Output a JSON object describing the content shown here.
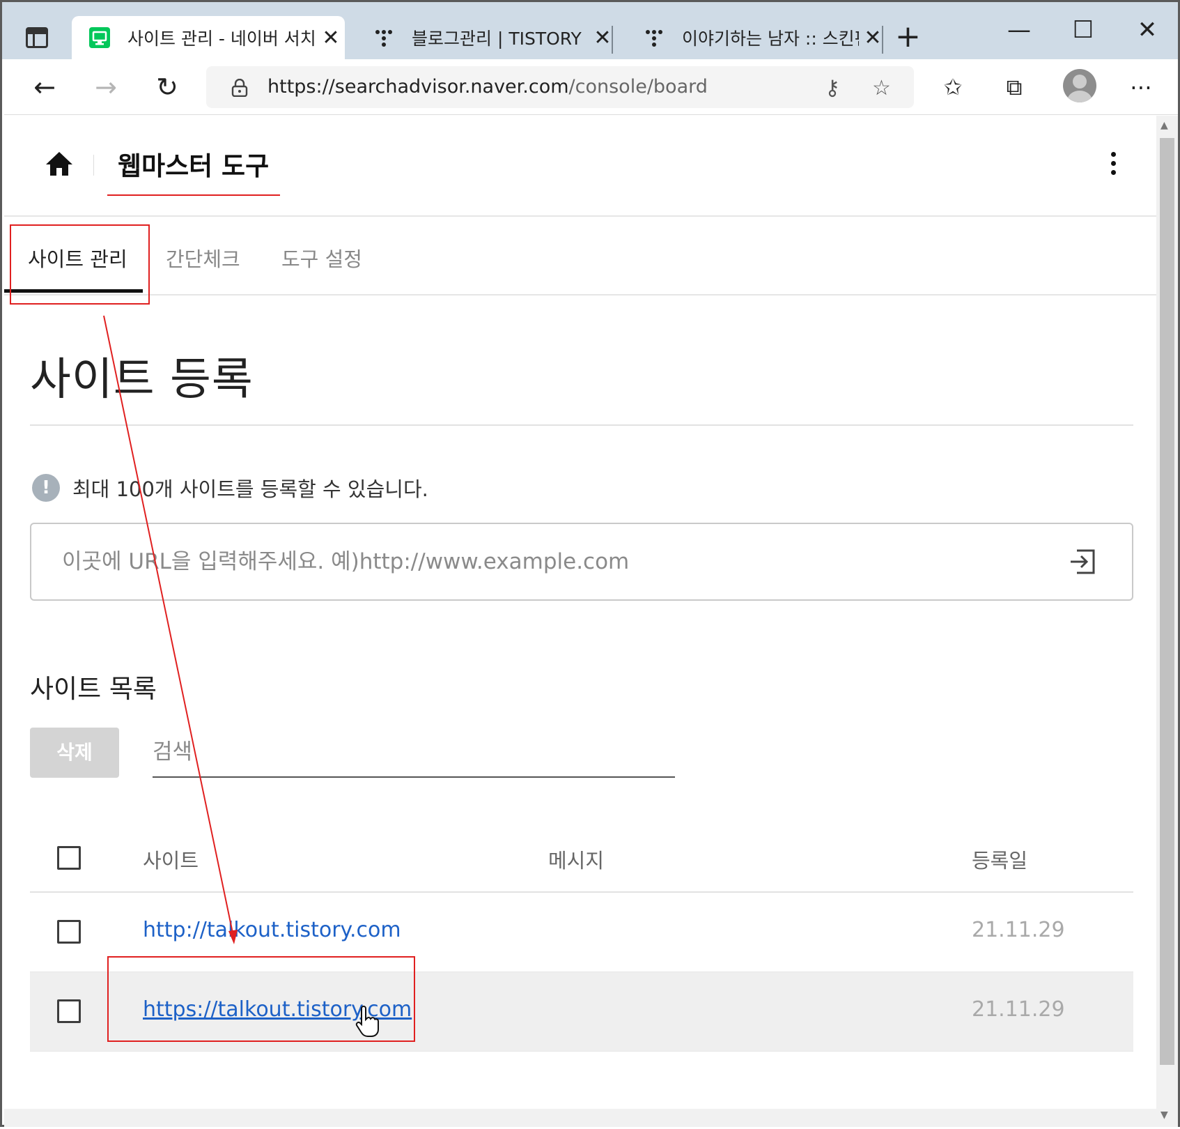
{
  "browser": {
    "tabs": [
      {
        "title": "사이트 관리 - 네이버 서치어드바이저",
        "icon": "naver-searchadvisor-icon",
        "active": true
      },
      {
        "title": "블로그관리 | TISTORY",
        "icon": "tistory-icon",
        "active": false
      },
      {
        "title": "이야기하는 남자 :: 스킨편집",
        "icon": "tistory-icon",
        "active": false
      }
    ],
    "url_host": "https://searchadvisor.naver.com",
    "url_path": "/console/board"
  },
  "header": {
    "title": "웹마스터 도구"
  },
  "page_tabs": [
    "사이트 관리",
    "간단체크",
    "도구 설정"
  ],
  "register": {
    "title": "사이트 등록",
    "notice_icon": "!",
    "notice": "최대 100개 사이트를 등록할 수 있습니다.",
    "input_placeholder": "이곳에 URL을 입력해주세요. 예)http://www.example.com",
    "input_value": ""
  },
  "site_list": {
    "title": "사이트 목록",
    "delete_label": "삭제",
    "search_placeholder": "검색",
    "columns": [
      "사이트",
      "메시지",
      "등록일"
    ],
    "rows": [
      {
        "site": "http://talkout.tistory.com",
        "message": "",
        "date": "21.11.29"
      },
      {
        "site": "https://talkout.tistory.com",
        "message": "",
        "date": "21.11.29"
      }
    ]
  },
  "colors": {
    "link": "#1d61c7",
    "annotation": "#e02020",
    "naver_green": "#03c75a"
  }
}
